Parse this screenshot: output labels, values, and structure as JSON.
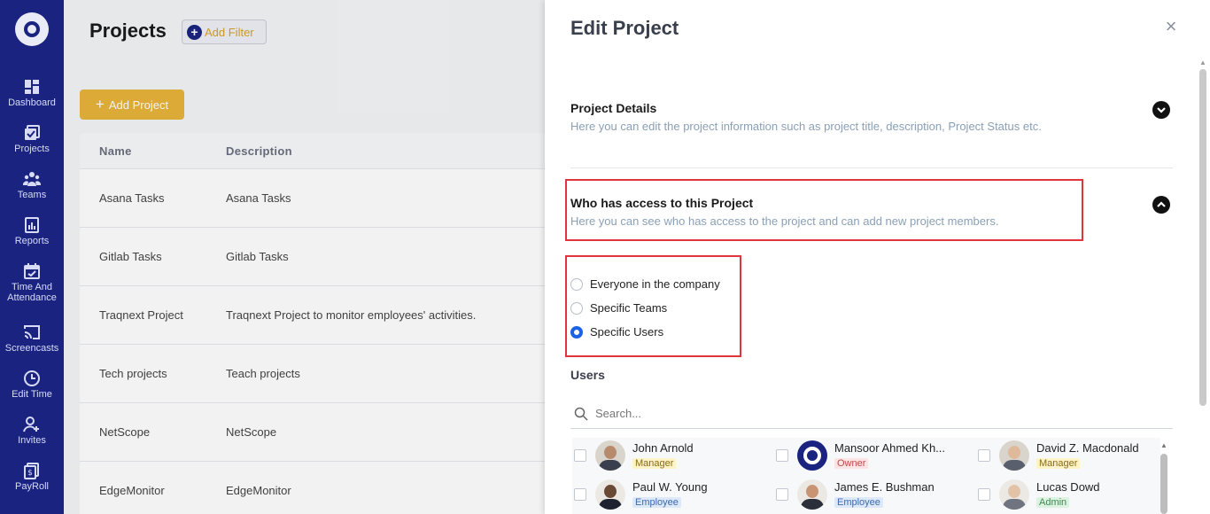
{
  "sidebar": {
    "logo": "traqnext-logo",
    "items": [
      {
        "label": "Dashboard",
        "icon": "dashboard-icon"
      },
      {
        "label": "Projects",
        "icon": "projects-icon"
      },
      {
        "label": "Teams",
        "icon": "teams-icon"
      },
      {
        "label": "Reports",
        "icon": "reports-icon"
      },
      {
        "label": "Time And Attendance",
        "icon": "calendar-icon"
      },
      {
        "label": "Screencasts",
        "icon": "cast-icon"
      },
      {
        "label": "Edit Time",
        "icon": "clock-icon"
      },
      {
        "label": "Invites",
        "icon": "invite-icon"
      },
      {
        "label": "PayRoll",
        "icon": "payroll-icon"
      }
    ]
  },
  "main": {
    "title": "Projects",
    "add_filter_label": "Add Filter",
    "add_project_label": "Add Project",
    "table": {
      "headers": [
        "Name",
        "Description"
      ],
      "rows": [
        {
          "name": "Asana Tasks",
          "description": "Asana Tasks"
        },
        {
          "name": "Gitlab Tasks",
          "description": "Gitlab Tasks"
        },
        {
          "name": "Traqnext Project",
          "description": "Traqnext Project to monitor employees' activities."
        },
        {
          "name": "Tech projects",
          "description": "Teach projects"
        },
        {
          "name": "NetScope",
          "description": "NetScope"
        },
        {
          "name": "EdgeMonitor",
          "description": "EdgeMonitor"
        }
      ]
    }
  },
  "drawer": {
    "title": "Edit Project",
    "close_icon": "close-icon",
    "project_details": {
      "title": "Project Details",
      "subtitle": "Here you can edit the project information such as project title, description, Project Status etc."
    },
    "access": {
      "title": "Who has access to this Project",
      "subtitle": "Here you can see who has access to the project and can add new project members.",
      "options": [
        "Everyone in the company",
        "Specific Teams",
        "Specific Users"
      ],
      "selected": "Specific Users"
    },
    "users_label": "Users",
    "search_placeholder": "Search...",
    "users": [
      {
        "name": "John Arnold",
        "role": "Manager"
      },
      {
        "name": "Mansoor Ahmed Kh...",
        "role": "Owner"
      },
      {
        "name": "David Z. Macdonald",
        "role": "Manager"
      },
      {
        "name": "Paul W. Young",
        "role": "Employee"
      },
      {
        "name": "James E. Bushman",
        "role": "Employee"
      },
      {
        "name": "Lucas Dowd",
        "role": "Admin"
      }
    ],
    "highlight_color": "#e2353b",
    "accent": "#1a2480"
  }
}
